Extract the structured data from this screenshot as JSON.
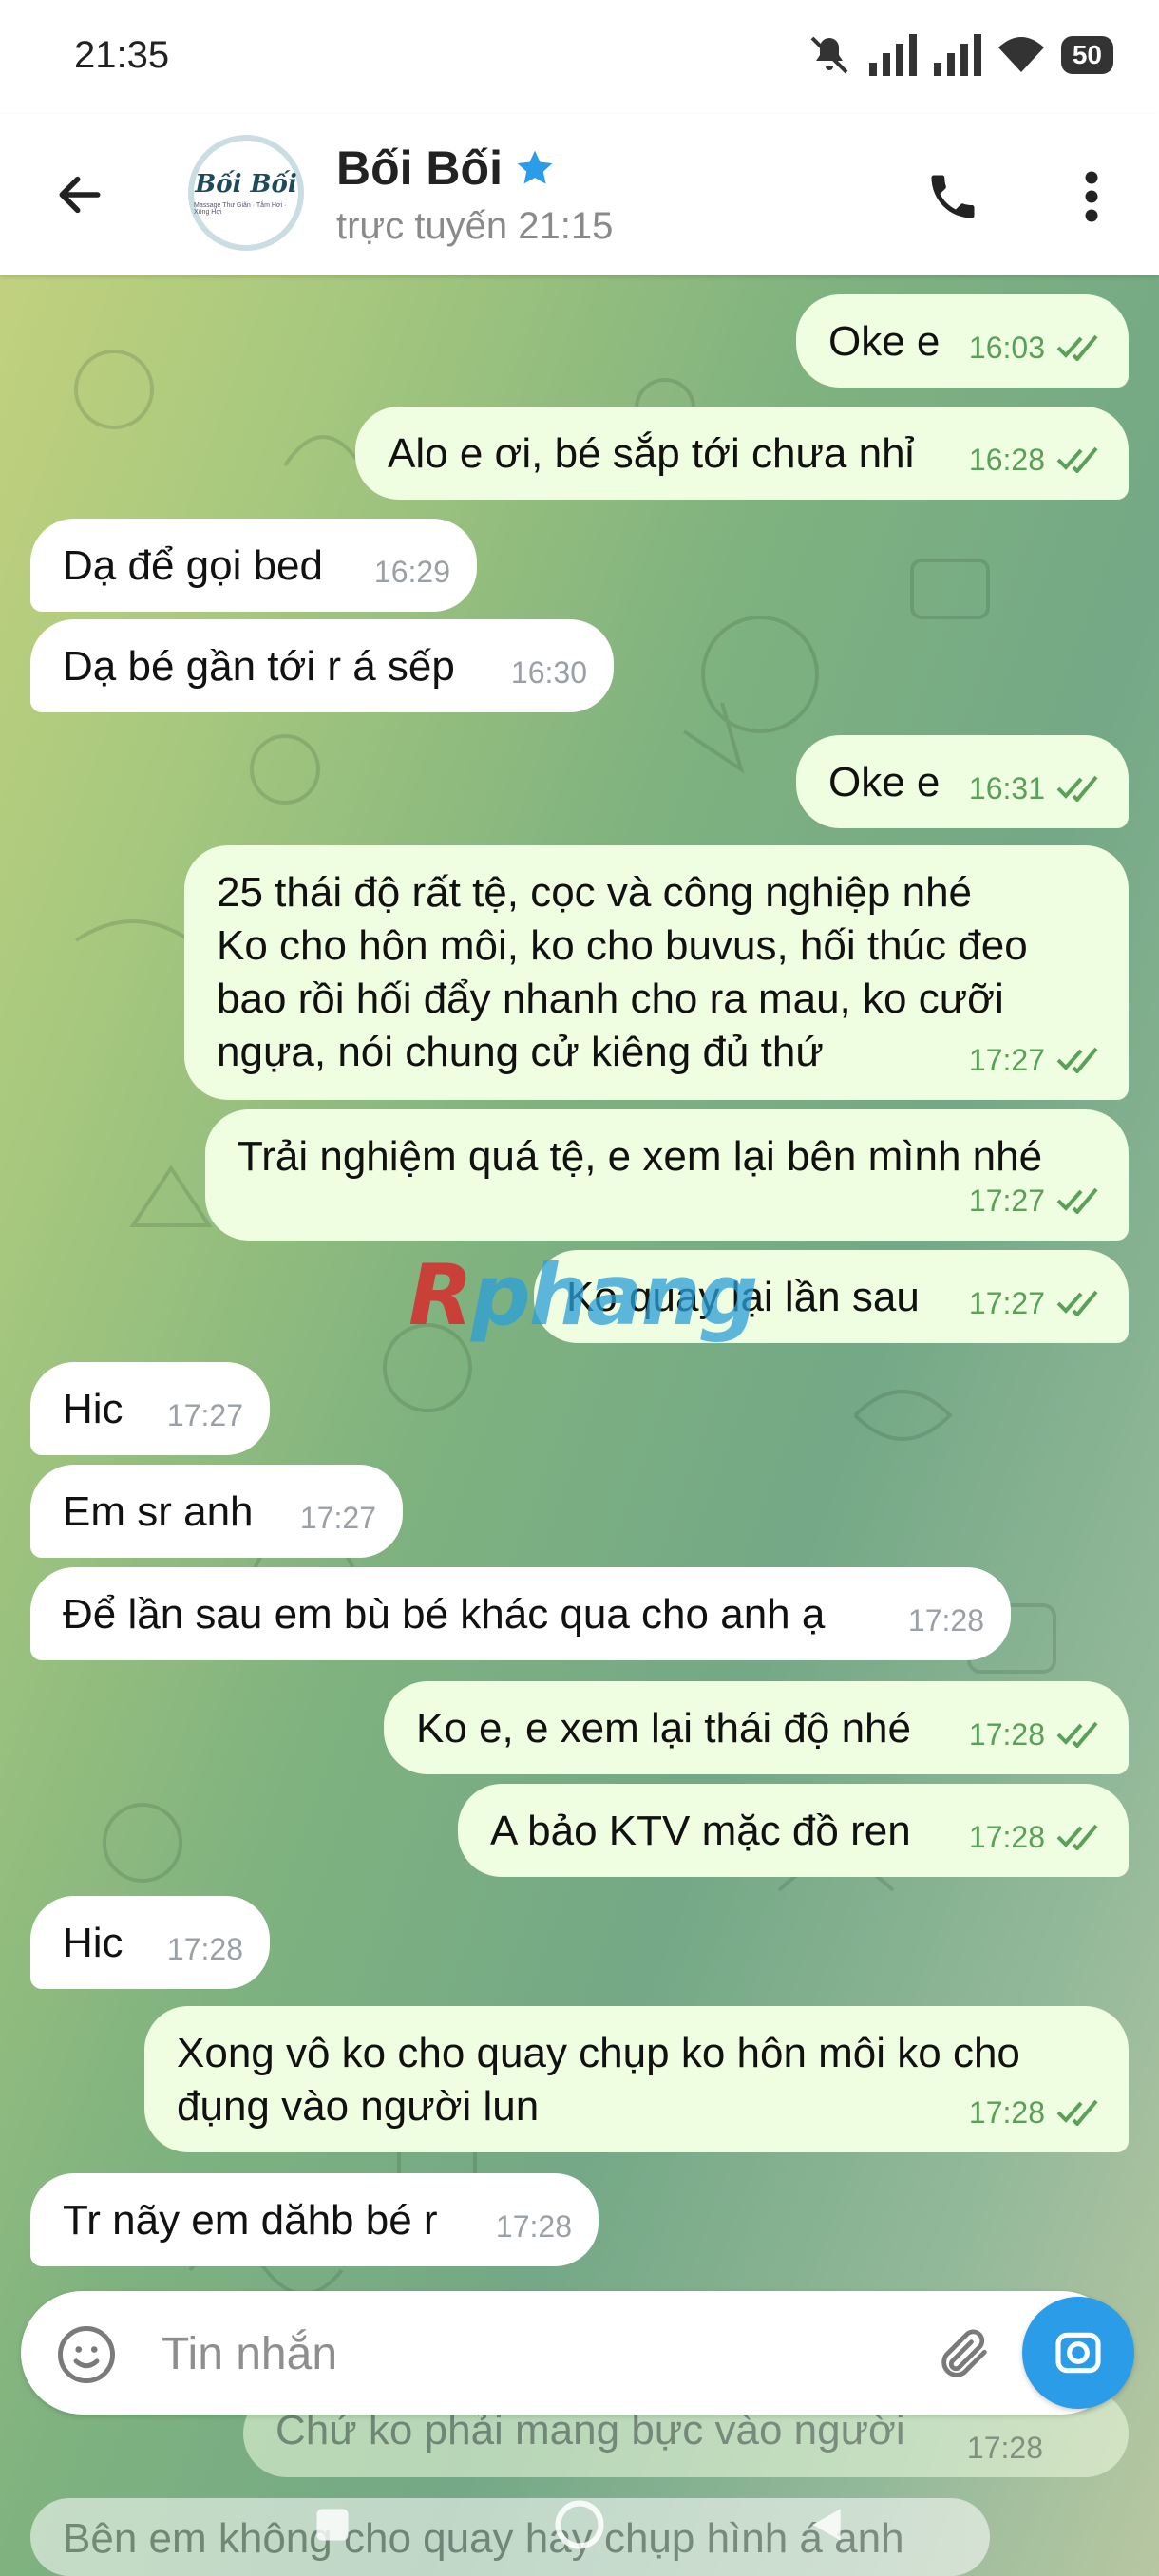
{
  "status_bar": {
    "time": "21:35",
    "battery": "50"
  },
  "header": {
    "contact_name": "Bối Bối",
    "contact_status": "trực tuyến 21:15",
    "avatar_logo": "Bối Bối",
    "avatar_sub": "Massage Thư Giãn · Tắm Hơi · Xông Hơi"
  },
  "messages": [
    {
      "dir": "out",
      "text": "Oke e",
      "time": "16:03"
    },
    {
      "dir": "out",
      "text": "Alo e ơi, bé sắp tới chưa nhỉ",
      "time": "16:28"
    },
    {
      "dir": "in",
      "text": "Dạ để gọi bed",
      "time": "16:29"
    },
    {
      "dir": "in",
      "text": "Dạ bé gần tới r á sếp",
      "time": "16:30"
    },
    {
      "dir": "out",
      "text": "Oke e",
      "time": "16:31"
    },
    {
      "dir": "out",
      "text": "25 thái độ rất tệ, cọc và công nghiệp nhé\nKo cho hôn môi, ko cho buvus, hối thúc đeo\nbao rồi hối đẩy nhanh cho ra mau, ko cưỡi\nngựa, nói chung cử kiêng đủ thứ",
      "time": "17:27"
    },
    {
      "dir": "out",
      "text": "Trải nghiệm quá tệ, e xem lại bên mình nhé",
      "time": "17:27"
    },
    {
      "dir": "out",
      "text": "Ko quay lại lần sau",
      "time": "17:27"
    },
    {
      "dir": "in",
      "text": "Hic",
      "time": "17:27"
    },
    {
      "dir": "in",
      "text": "Em sr anh",
      "time": "17:27"
    },
    {
      "dir": "in",
      "text": "Để lần sau em bù bé khác qua cho anh ạ",
      "time": "17:28"
    },
    {
      "dir": "out",
      "text": "Ko e, e xem lại thái độ nhé",
      "time": "17:28"
    },
    {
      "dir": "out",
      "text": "A bảo KTV mặc đồ ren",
      "time": "17:28"
    },
    {
      "dir": "in",
      "text": "Hic",
      "time": "17:28"
    },
    {
      "dir": "out",
      "text": "Xong vô ko cho quay chụp ko hôn môi ko cho\nđụng vào người lun",
      "time": "17:28"
    },
    {
      "dir": "in",
      "text": "Tr nãy em dăhb bé r",
      "time": "17:28"
    }
  ],
  "faded_messages": [
    {
      "dir": "out",
      "text": "Chứ ko phải mang bực vào người",
      "time": "17:28"
    },
    {
      "dir": "in",
      "text": "Bên em không cho quay hay chụp hình á anh",
      "time": ""
    }
  ],
  "composer": {
    "placeholder": "Tin nhắn"
  },
  "watermark": {
    "part1": "R",
    "part2": "phang"
  },
  "colors": {
    "accent": "#2b9ce8",
    "outgoing_bubble": "#effde0",
    "incoming_bubble": "#ffffff",
    "read_check": "#5aa05a"
  }
}
